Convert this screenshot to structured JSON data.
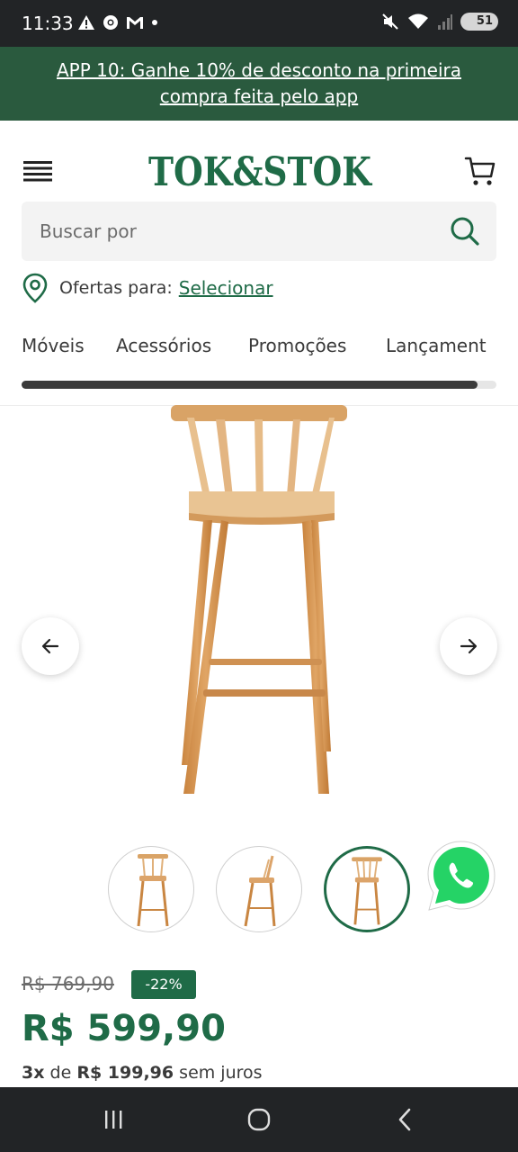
{
  "status_bar": {
    "time": "11:33",
    "battery": "51",
    "left_icons": [
      "warning-icon",
      "chrome-icon",
      "gmail-icon",
      "dot-icon"
    ],
    "right_icons": [
      "mute-icon",
      "wifi-icon",
      "signal-icon",
      "battery-icon"
    ]
  },
  "promo": {
    "text": "APP 10: Ganhe 10% de desconto na primeira compra feita pelo app"
  },
  "header": {
    "logo_text": "TOK&STOK"
  },
  "search": {
    "placeholder": "Buscar por"
  },
  "offers": {
    "label": "Ofertas para:",
    "link": "Selecionar"
  },
  "categories": [
    "Móveis",
    "Acessórios",
    "Promoções",
    "Lançament"
  ],
  "category_scroll_fraction": 0.96,
  "product": {
    "old_price": "R$ 769,90",
    "discount": "-22%",
    "price": "R$ 599,90",
    "installments_count": "3x",
    "installments_de": "de",
    "installments_value": "R$ 199,96",
    "installments_suffix": "sem juros"
  },
  "colors": {
    "brand_green": "#1f6b47",
    "promo_bg": "#2a5a3e",
    "system_bar": "#222426",
    "whatsapp_green": "#25d366"
  }
}
